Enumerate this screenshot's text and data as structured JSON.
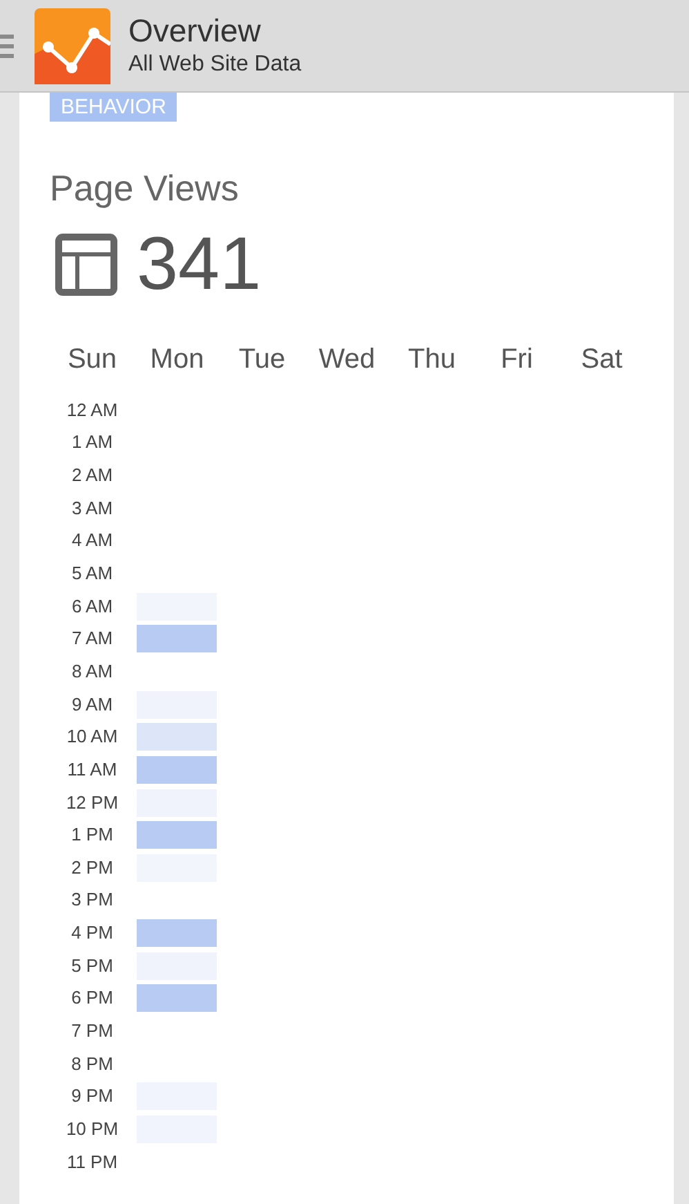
{
  "header": {
    "title": "Overview",
    "subtitle": "All Web Site Data"
  },
  "section_tag": "BEHAVIOR",
  "metric": {
    "label": "Page Views",
    "value": "341"
  },
  "days": [
    "Sun",
    "Mon",
    "Tue",
    "Wed",
    "Thu",
    "Fri",
    "Sat"
  ],
  "rows": [
    {
      "hour": "12 AM",
      "cells": [
        null,
        null,
        null,
        null,
        null,
        null
      ]
    },
    {
      "hour": "1 AM",
      "cells": [
        null,
        null,
        null,
        null,
        null,
        null
      ]
    },
    {
      "hour": "2 AM",
      "cells": [
        null,
        null,
        null,
        null,
        null,
        null
      ]
    },
    {
      "hour": "3 AM",
      "cells": [
        null,
        null,
        null,
        null,
        null,
        null
      ]
    },
    {
      "hour": "4 AM",
      "cells": [
        null,
        null,
        null,
        null,
        null,
        null
      ]
    },
    {
      "hour": "5 AM",
      "cells": [
        null,
        null,
        null,
        null,
        null,
        null
      ]
    },
    {
      "hour": "6 AM",
      "cells": [
        {
          "color": "#f2f5fc"
        },
        null,
        null,
        null,
        null,
        null
      ]
    },
    {
      "hour": "7 AM",
      "cells": [
        {
          "color": "#b8cbf2"
        },
        null,
        null,
        null,
        null,
        null
      ]
    },
    {
      "hour": "8 AM",
      "cells": [
        null,
        null,
        null,
        null,
        null,
        null
      ]
    },
    {
      "hour": "9 AM",
      "cells": [
        {
          "color": "#f0f3fb"
        },
        null,
        null,
        null,
        null,
        null
      ]
    },
    {
      "hour": "10 AM",
      "cells": [
        {
          "color": "#dde6f8"
        },
        null,
        null,
        null,
        null,
        null
      ]
    },
    {
      "hour": "11 AM",
      "cells": [
        {
          "color": "#b8cbf2"
        },
        null,
        null,
        null,
        null,
        null
      ]
    },
    {
      "hour": "12 PM",
      "cells": [
        {
          "color": "#f0f3fb"
        },
        null,
        null,
        null,
        null,
        null
      ]
    },
    {
      "hour": "1 PM",
      "cells": [
        {
          "color": "#b8cbf2"
        },
        null,
        null,
        null,
        null,
        null
      ]
    },
    {
      "hour": "2 PM",
      "cells": [
        {
          "color": "#f2f5fc"
        },
        null,
        null,
        null,
        null,
        null
      ]
    },
    {
      "hour": "3 PM",
      "cells": [
        null,
        null,
        null,
        null,
        null,
        null
      ]
    },
    {
      "hour": "4 PM",
      "cells": [
        {
          "color": "#b8cbf2"
        },
        null,
        null,
        null,
        null,
        null
      ]
    },
    {
      "hour": "5 PM",
      "cells": [
        {
          "color": "#f0f3fb"
        },
        null,
        null,
        null,
        null,
        null
      ]
    },
    {
      "hour": "6 PM",
      "cells": [
        {
          "color": "#b8cbf2"
        },
        null,
        null,
        null,
        null,
        null
      ]
    },
    {
      "hour": "7 PM",
      "cells": [
        null,
        null,
        null,
        null,
        null,
        null
      ]
    },
    {
      "hour": "8 PM",
      "cells": [
        null,
        null,
        null,
        null,
        null,
        null
      ]
    },
    {
      "hour": "9 PM",
      "cells": [
        {
          "color": "#f1f4fc"
        },
        null,
        null,
        null,
        null,
        null
      ]
    },
    {
      "hour": "10 PM",
      "cells": [
        {
          "color": "#f1f4fc"
        },
        null,
        null,
        null,
        null,
        null
      ]
    },
    {
      "hour": "11 PM",
      "cells": [
        null,
        null,
        null,
        null,
        null,
        null
      ]
    }
  ]
}
